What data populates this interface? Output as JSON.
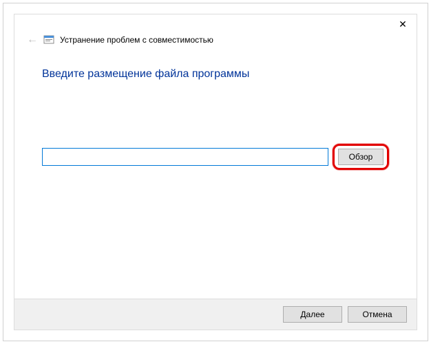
{
  "header": {
    "title": "Устранение проблем с совместимостью"
  },
  "content": {
    "instruction": "Введите размещение файла программы",
    "path_value": "",
    "path_placeholder": ""
  },
  "buttons": {
    "browse": "Обзор",
    "next": "Далее",
    "cancel": "Отмена"
  }
}
